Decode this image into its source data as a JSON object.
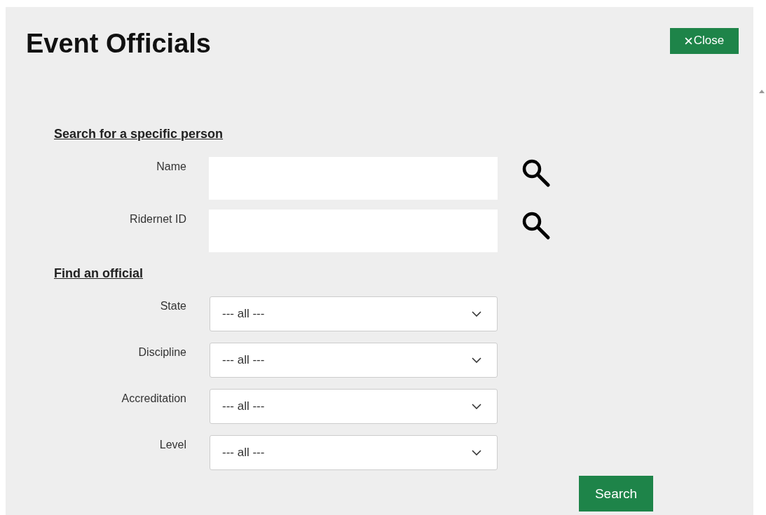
{
  "title": "Event Officials",
  "close_button": {
    "label": "Close"
  },
  "sections": [
    {
      "heading": "Search for a specific person",
      "fields": [
        {
          "kind": "text",
          "label": "Name"
        },
        {
          "kind": "text",
          "label": "Ridernet ID"
        }
      ]
    },
    {
      "heading": "Find an official",
      "fields": [
        {
          "kind": "select",
          "label": "State",
          "value": "--- all ---"
        },
        {
          "kind": "select",
          "label": "Discipline",
          "value": "--- all ---"
        },
        {
          "kind": "select",
          "label": "Accreditation",
          "value": "--- all ---"
        },
        {
          "kind": "select",
          "label": "Level",
          "value": "--- all ---"
        }
      ]
    }
  ],
  "search_button": {
    "label": "Search"
  }
}
